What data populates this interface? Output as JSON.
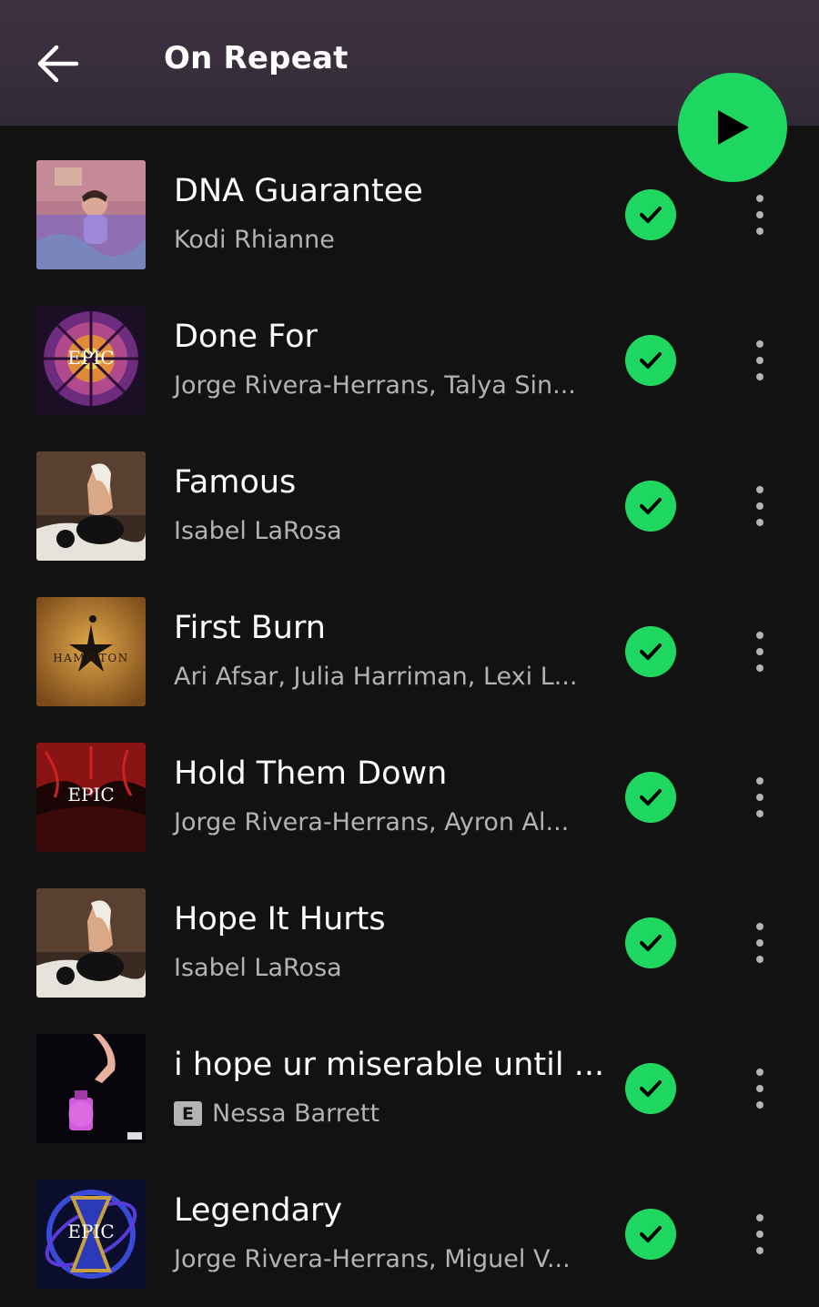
{
  "header": {
    "title": "On Repeat",
    "back_icon": "back-arrow-icon",
    "play_icon": "play-icon",
    "accent_color": "#1ed760"
  },
  "tracks": [
    {
      "title": "DNA Guarantee",
      "artist": "Kodi Rhianne",
      "explicit": false,
      "liked": true
    },
    {
      "title": "Done For",
      "artist": "Jorge Rivera-Herrans, Talya Sin...",
      "explicit": false,
      "liked": true
    },
    {
      "title": "Famous",
      "artist": "Isabel LaRosa",
      "explicit": false,
      "liked": true
    },
    {
      "title": "First Burn",
      "artist": "Ari Afsar, Julia Harriman, Lexi L...",
      "explicit": false,
      "liked": true,
      "art_text": "HAMILTON"
    },
    {
      "title": "Hold Them Down",
      "artist": "Jorge Rivera-Herrans, Ayron Al...",
      "explicit": false,
      "liked": true,
      "art_text": "EPIC"
    },
    {
      "title": "Hope It Hurts",
      "artist": "Isabel LaRosa",
      "explicit": false,
      "liked": true
    },
    {
      "title": "i hope ur miserable until ...",
      "artist": "Nessa Barrett",
      "explicit": true,
      "explicit_label": "E",
      "liked": true
    },
    {
      "title": "Legendary",
      "artist": "Jorge Rivera-Herrans, Miguel V...",
      "explicit": false,
      "liked": true,
      "art_text": "EPIC"
    }
  ],
  "epic_art_text": "EPIC"
}
